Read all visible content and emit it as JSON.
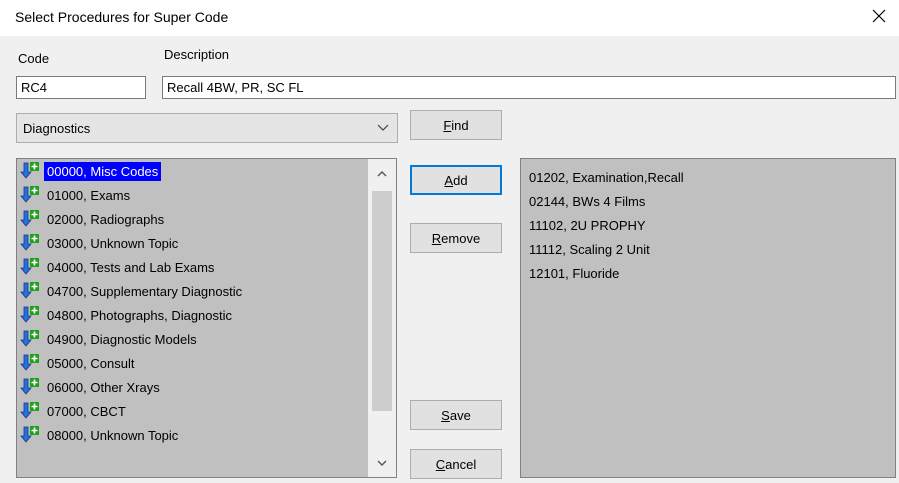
{
  "window": {
    "title": "Select Procedures for Super Code"
  },
  "form": {
    "code_label": "Code",
    "code_value": "RC4",
    "description_label": "Description",
    "description_value": "Recall 4BW, PR, SC FL"
  },
  "category": {
    "selected": "Diagnostics"
  },
  "buttons": {
    "find": {
      "mnemonic": "F",
      "rest": "ind"
    },
    "add": {
      "mnemonic": "A",
      "rest": "dd"
    },
    "remove": {
      "mnemonic": "R",
      "rest": "emove"
    },
    "save": {
      "mnemonic": "S",
      "rest": "ave"
    },
    "cancel": {
      "mnemonic": "C",
      "rest": "ancel"
    }
  },
  "available_procedures": [
    "00000, Misc Codes",
    "01000, Exams",
    "02000, Radiographs",
    "03000, Unknown Topic",
    "04000, Tests and Lab Exams",
    "04700, Supplementary Diagnostic",
    "04800, Photographs, Diagnostic",
    "04900, Diagnostic Models",
    "05000, Consult",
    "06000, Other Xrays",
    "07000, CBCT",
    "08000, Unknown Topic"
  ],
  "selected_procedures": [
    "01202, Examination,Recall",
    "02144, BWs 4 Films",
    "11102, 2U PROPHY",
    "11112, Scaling 2 Unit",
    "12101, Fluoride"
  ],
  "colors": {
    "selection_bg": "#0000ff",
    "list_bg": "#c0c0c0",
    "default_button_border": "#0078d7"
  }
}
